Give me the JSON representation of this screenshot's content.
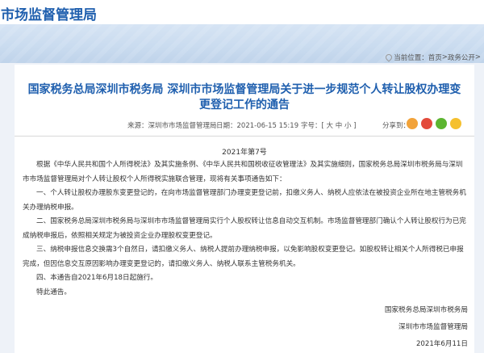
{
  "site": {
    "title": "市场监督管理局"
  },
  "breadcrumb": {
    "prefix": "当前位置：",
    "home": "首页",
    "sep": " > ",
    "section": "政务公开",
    "tail": " > "
  },
  "article": {
    "title": "国家税务总局深圳市税务局 深圳市市场监督管理局关于进一步规范个人转让股权办理变更登记工作的通告",
    "source_label": "来源：",
    "source": "深圳市市场监督管理局",
    "date_label": "日期：",
    "date": "2021-06-15 15:19",
    "size_label": "字号：",
    "size_options": "[ 大  中  小 ]",
    "share_label": "分享到：",
    "doc_number": "2021年第7号",
    "paragraphs": [
      "根据《中华人民共和国个人所得税法》及其实施条例、《中华人民共和国税收征收管理法》及其实施细则，国家税务总局深圳市税务局与深圳市市场监督管理局对个人转让股权个人所得税实施联合管理，现将有关事项通告如下：",
      "一、个人转让股权办理股东变更登记的，在向市场监督管理部门办理变更登记前，扣缴义务人、纳税人应依法在被投资企业所在地主管税务机关办理纳税申报。",
      "二、国家税务总局深圳市税务局与深圳市市场监督管理局实行个人股权转让信息自动交互机制。市场监督管理部门确认个人转让股权行为已完成纳税申报后，依照相关规定为被投资企业办理股权变更登记。",
      "三、纳税申报信息交换需3个自然日，请扣缴义务人、纳税人提前办理纳税申报，以免影响股权变更登记。如股权转让相关个人所得税已申报完成，但因信息交互原因影响办理变更登记的，请扣缴义务人、纳税人联系主管税务机关。",
      "四、本通告自2021年6月18日起施行。",
      "特此通告。"
    ],
    "signoff": [
      "国家税务总局深圳市税务局",
      "深圳市市场监督管理局",
      "2021年6月11日"
    ]
  },
  "colors": {
    "brand": "#1f5fae",
    "share_icons": [
      "#f2a33a",
      "#e34a3b",
      "#5cb531",
      "#f5c02e"
    ]
  },
  "icons": {
    "share": [
      "qzone-icon",
      "weibo-icon",
      "wechat-icon",
      "share-more-icon"
    ]
  }
}
